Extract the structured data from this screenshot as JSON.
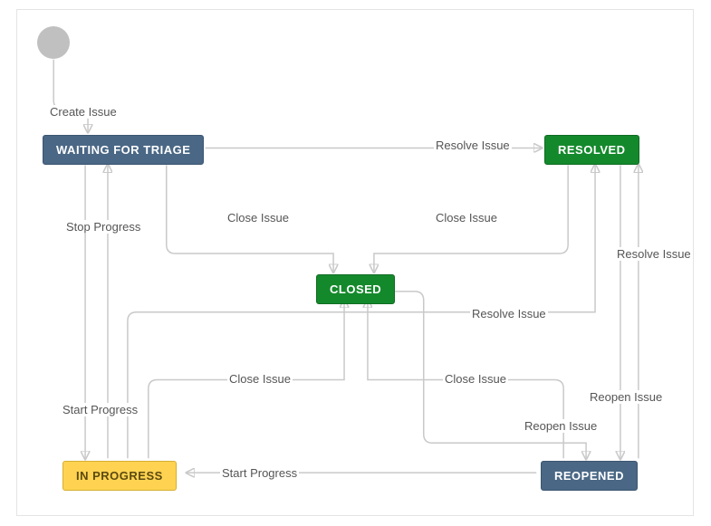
{
  "chart_data": {
    "type": "state-diagram",
    "title": "",
    "start": "START",
    "states": [
      {
        "id": "START",
        "label": "",
        "kind": "initial"
      },
      {
        "id": "WAITING_FOR_TRIAGE",
        "label": "WAITING FOR TRIAGE",
        "kind": "todo"
      },
      {
        "id": "RESOLVED",
        "label": "RESOLVED",
        "kind": "done"
      },
      {
        "id": "CLOSED",
        "label": "CLOSED",
        "kind": "done"
      },
      {
        "id": "IN_PROGRESS",
        "label": "IN PROGRESS",
        "kind": "inprogress"
      },
      {
        "id": "REOPENED",
        "label": "REOPENED",
        "kind": "todo"
      }
    ],
    "transitions": [
      {
        "from": "START",
        "to": "WAITING_FOR_TRIAGE",
        "label": "Create Issue"
      },
      {
        "from": "WAITING_FOR_TRIAGE",
        "to": "RESOLVED",
        "label": "Resolve Issue"
      },
      {
        "from": "WAITING_FOR_TRIAGE",
        "to": "CLOSED",
        "label": "Close Issue"
      },
      {
        "from": "RESOLVED",
        "to": "CLOSED",
        "label": "Close Issue"
      },
      {
        "from": "IN_PROGRESS",
        "to": "WAITING_FOR_TRIAGE",
        "label": "Stop Progress"
      },
      {
        "from": "WAITING_FOR_TRIAGE",
        "to": "IN_PROGRESS",
        "label": "Start Progress"
      },
      {
        "from": "IN_PROGRESS",
        "to": "RESOLVED",
        "label": "Resolve Issue"
      },
      {
        "from": "IN_PROGRESS",
        "to": "CLOSED",
        "label": "Close Issue"
      },
      {
        "from": "REOPENED",
        "to": "CLOSED",
        "label": "Close Issue"
      },
      {
        "from": "REOPENED",
        "to": "RESOLVED",
        "label": "Resolve Issue"
      },
      {
        "from": "RESOLVED",
        "to": "REOPENED",
        "label": "Reopen Issue"
      },
      {
        "from": "CLOSED",
        "to": "REOPENED",
        "label": "Reopen Issue"
      },
      {
        "from": "REOPENED",
        "to": "IN_PROGRESS",
        "label": "Start Progress"
      }
    ]
  },
  "nodes": {
    "waiting": "WAITING FOR TRIAGE",
    "resolved": "RESOLVED",
    "closed": "CLOSED",
    "inprogress": "IN PROGRESS",
    "reopened": "REOPENED"
  },
  "labels": {
    "create": "Create Issue",
    "resolve1": "Resolve Issue",
    "close1": "Close Issue",
    "close2": "Close Issue",
    "stop": "Stop Progress",
    "resolve2": "Resolve Issue",
    "resolve3": "Resolve Issue",
    "close3": "Close Issue",
    "close4": "Close Issue",
    "start": "Start Progress",
    "start2": "Start Progress",
    "reopen1": "Reopen Issue",
    "reopen2": "Reopen Issue"
  }
}
